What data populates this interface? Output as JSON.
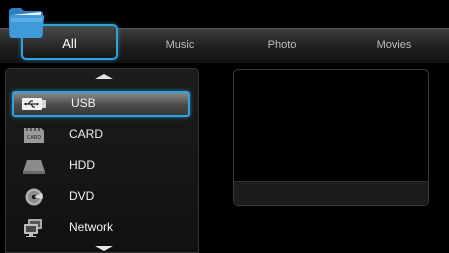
{
  "tabs": [
    {
      "label": "All",
      "active": true
    },
    {
      "label": "Music",
      "active": false
    },
    {
      "label": "Photo",
      "active": false
    },
    {
      "label": "Movies",
      "active": false
    }
  ],
  "sources": [
    {
      "label": "USB",
      "icon": "usb-icon",
      "selected": true
    },
    {
      "label": "CARD",
      "icon": "card-icon",
      "icon_text": "CARD",
      "selected": false
    },
    {
      "label": "HDD",
      "icon": "hdd-icon",
      "selected": false
    },
    {
      "label": "DVD",
      "icon": "dvd-icon",
      "selected": false
    },
    {
      "label": "Network",
      "icon": "network-icon",
      "selected": false
    }
  ],
  "colors": {
    "accent": "#2aa3de",
    "background": "#000000"
  }
}
